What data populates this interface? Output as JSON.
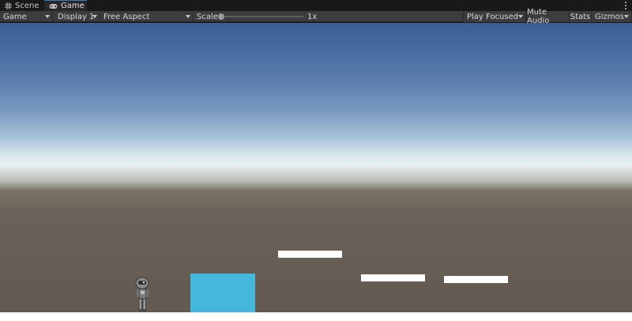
{
  "tabs": [
    {
      "label": "Scene",
      "icon": "grid-icon",
      "active": false
    },
    {
      "label": "Game",
      "icon": "gamepad-icon",
      "active": true
    }
  ],
  "toolbar": {
    "mode": "Game",
    "display": "Display 1",
    "aspect": "Free Aspect",
    "scale_label": "Scale",
    "scale_value": "1x",
    "play_mode": "Play Focused",
    "mute_label": "Mute Audio",
    "stats_label": "Stats",
    "gizmos_label": "Gizmos"
  },
  "colors": {
    "sky_top": "#3a5e94",
    "horizon": "#e9f1f2",
    "ground": "#625a52",
    "cube": "#43b8dc",
    "platform": "#ffffff",
    "active_tab_accent": "#3a79bb"
  },
  "scene": {
    "objects": [
      "robot-character",
      "cube",
      "platform",
      "platform",
      "platform",
      "ground"
    ]
  }
}
